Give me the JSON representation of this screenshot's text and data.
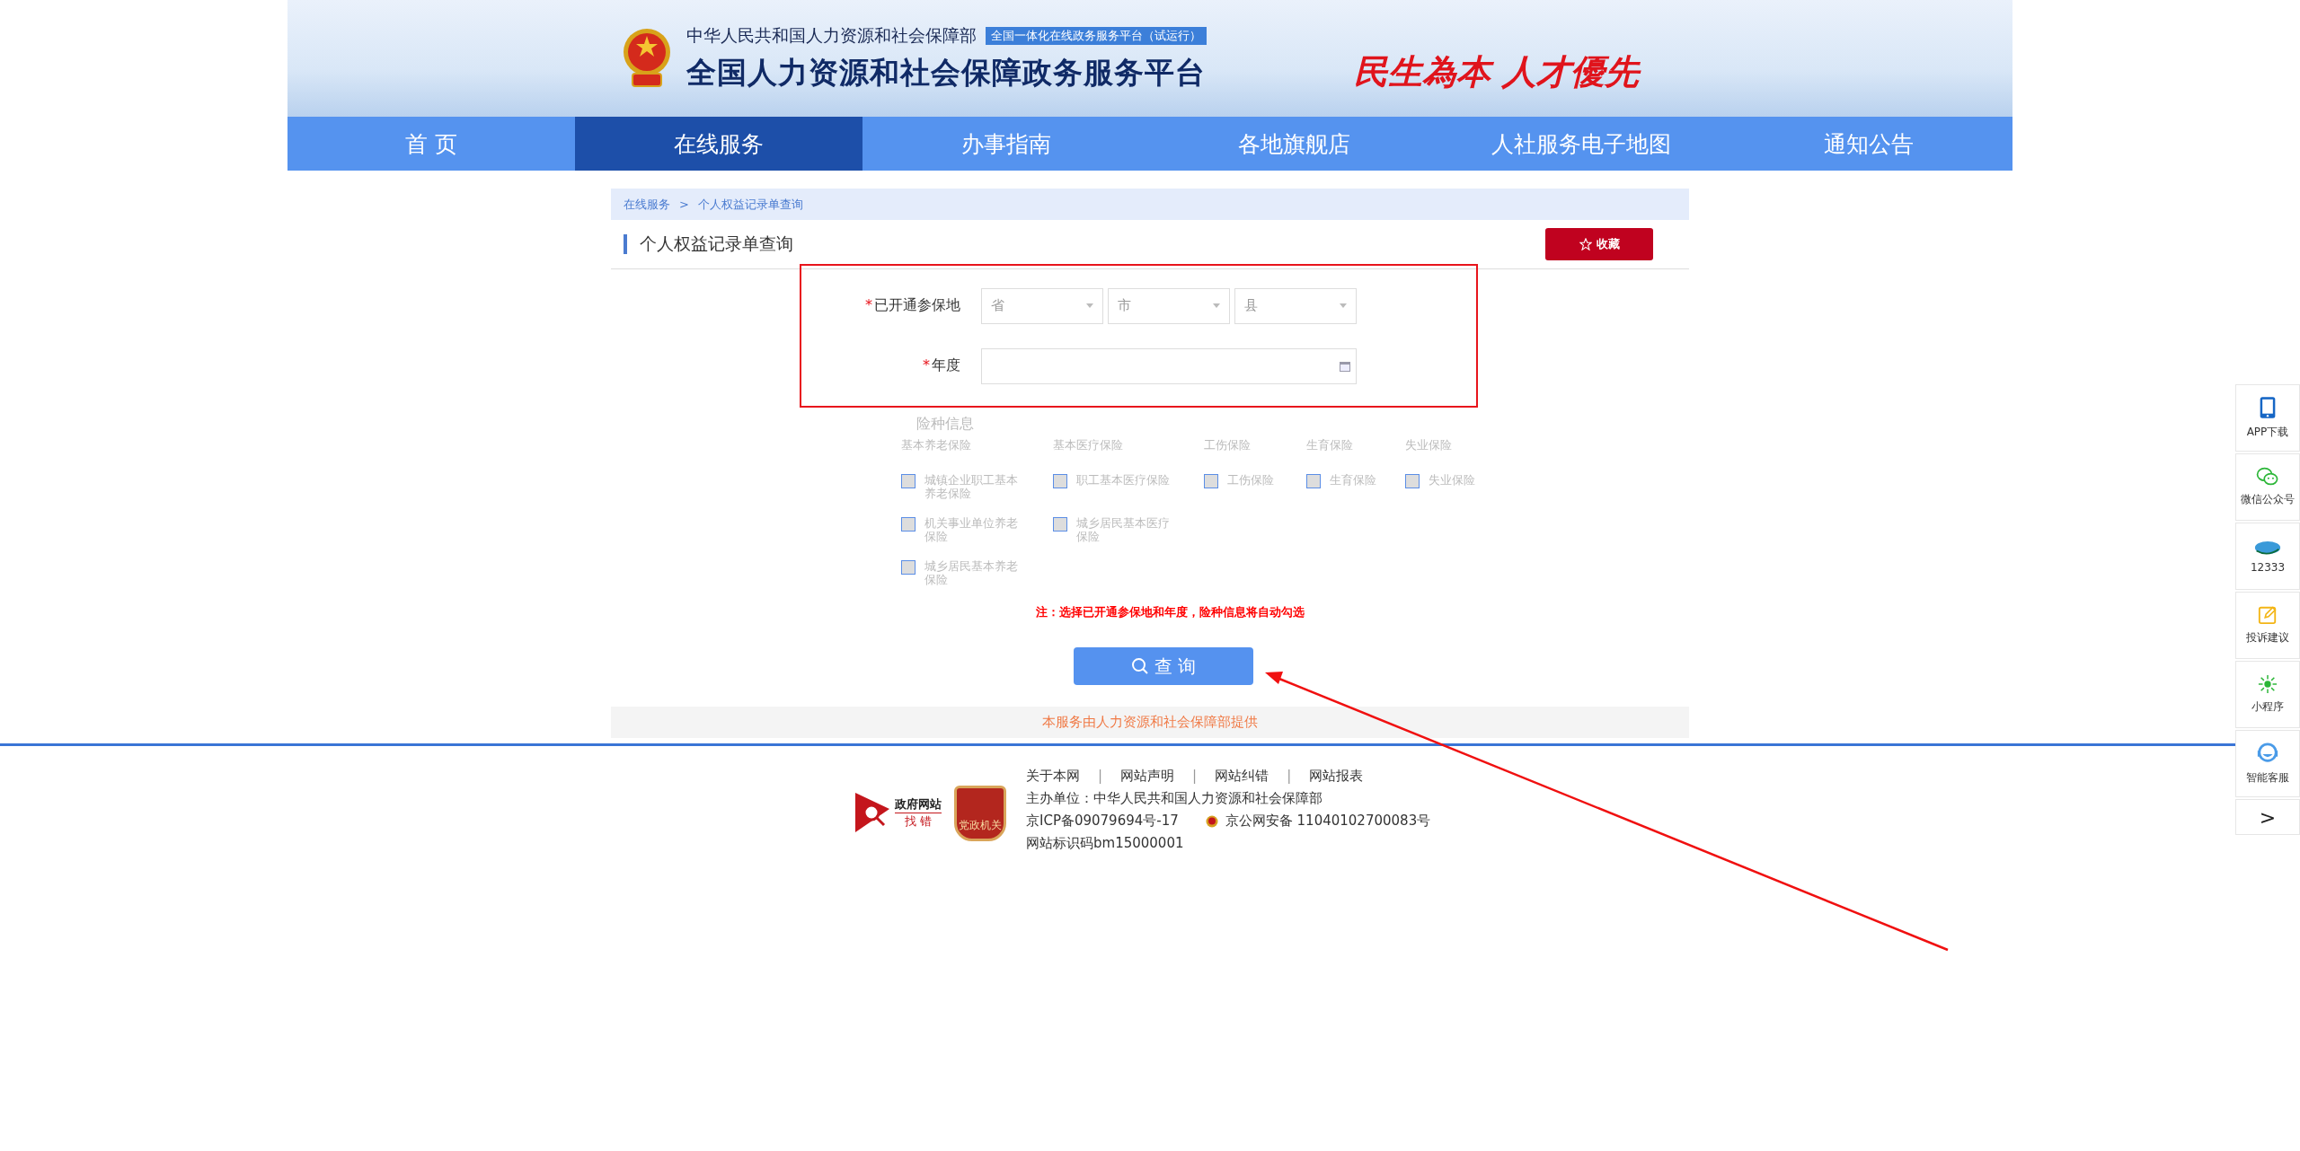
{
  "header": {
    "ministry": "中华人民共和国人力资源和社会保障部",
    "badge": "全国一体化在线政务服务平台（试运行）",
    "title": "全国人力资源和社会保障政务服务平台",
    "slogan": "民生為本 人才優先"
  },
  "nav": [
    {
      "label": "首 页",
      "selected": false
    },
    {
      "label": "在线服务",
      "selected": true
    },
    {
      "label": "办事指南",
      "selected": false
    },
    {
      "label": "各地旗舰店",
      "selected": false
    },
    {
      "label": "人社服务电子地图",
      "selected": false
    },
    {
      "label": "通知公告",
      "selected": false
    }
  ],
  "breadcrumb": [
    "在线服务",
    "个人权益记录单查询"
  ],
  "breadcrumb_separator": ">",
  "page_title": "个人权益记录单查询",
  "favorite_button": "收藏",
  "form": {
    "highlighted": true,
    "required_mark": "*",
    "region": {
      "label": "已开通参保地",
      "required": true,
      "selects": [
        {
          "placeholder": "省"
        },
        {
          "placeholder": "市"
        },
        {
          "placeholder": "县"
        }
      ]
    },
    "year": {
      "label": "年度",
      "required": true
    }
  },
  "insurance": {
    "title": "险种信息",
    "groups": [
      {
        "name": "基本养老保险",
        "items": [
          {
            "label": "城镇企业职工基本养老保险",
            "checked": false
          },
          {
            "label": "机关事业单位养老保险",
            "checked": false
          },
          {
            "label": "城乡居民基本养老保险",
            "checked": false
          }
        ]
      },
      {
        "name": "基本医疗保险",
        "items": [
          {
            "label": "职工基本医疗保险",
            "checked": false
          },
          {
            "label": "城乡居民基本医疗保险",
            "checked": false
          }
        ]
      },
      {
        "name": "工伤保险",
        "items": [
          {
            "label": "工伤保险",
            "checked": false
          }
        ]
      },
      {
        "name": "生育保险",
        "items": [
          {
            "label": "生育保险",
            "checked": false
          }
        ]
      },
      {
        "name": "失业保险",
        "items": [
          {
            "label": "失业保险",
            "checked": false
          }
        ]
      }
    ]
  },
  "note": "注：选择已开通参保地和年度，险种信息将自动勾选",
  "query_button": "查 询",
  "provider_note": "本服务由人力资源和社会保障部提供",
  "footer": {
    "badge_top": "政府网站",
    "badge_bottom": "找 错",
    "party_badge": "党政机关",
    "links": [
      "关于本网",
      "网站声明",
      "网站纠错",
      "网站报表"
    ],
    "link_separator": "|",
    "sponsor": "主办单位：中华人民共和国人力资源和社会保障部",
    "icp": "京ICP备09079694号-17",
    "police": "京公网安备 11040102700083号",
    "site_code": "网站标识码bm15000001"
  },
  "side_tools": [
    {
      "kind": "phone",
      "label": "APP下载"
    },
    {
      "kind": "wechat",
      "label": "微信公众号"
    },
    {
      "kind": "hotline",
      "label": "12333"
    },
    {
      "kind": "edit",
      "label": "投诉建议"
    },
    {
      "kind": "miniapp",
      "label": "小程序"
    },
    {
      "kind": "service",
      "label": "智能客服"
    },
    {
      "kind": "next",
      "label": ">"
    }
  ],
  "annotation_arrow": true
}
